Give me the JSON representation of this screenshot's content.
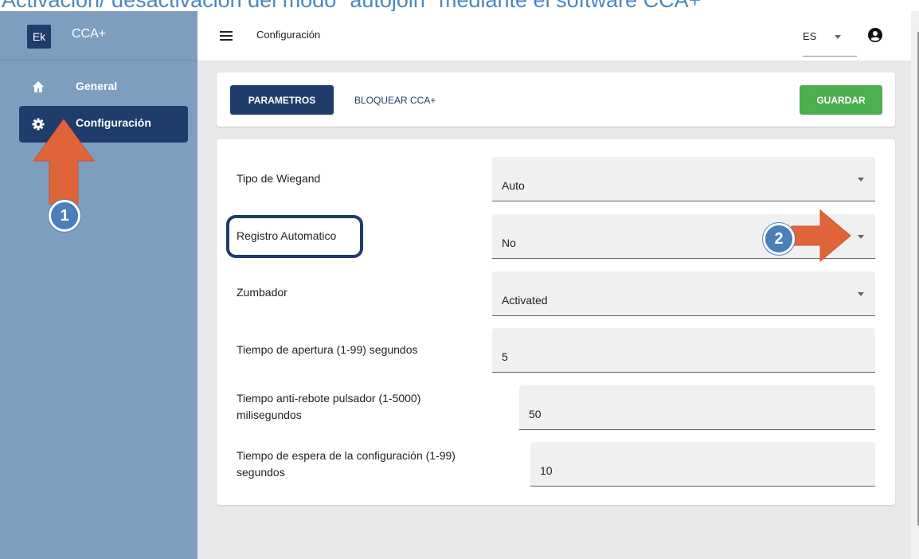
{
  "caption": "Activación/ desactivación del modo \"autojoin\" mediante el software CCA+",
  "app": {
    "logo": "Ek",
    "name": "CCA+"
  },
  "sidebar": {
    "items": [
      {
        "label": "General",
        "icon": "home-icon",
        "active": false
      },
      {
        "label": "Configuración",
        "icon": "gear-icon",
        "active": true
      }
    ]
  },
  "topbar": {
    "title": "Configuración",
    "language": "ES"
  },
  "toolbar": {
    "params_label": "PARAMETROS",
    "lock_label": "BLOQUEAR CCA+",
    "save_label": "GUARDAR"
  },
  "form": {
    "fields": [
      {
        "label": "Tipo de Wiegand",
        "value": "Auto",
        "type": "select"
      },
      {
        "label": "Registro Automatico",
        "value": "No",
        "type": "select"
      },
      {
        "label": "Zumbador",
        "value": "Activated",
        "type": "select"
      },
      {
        "label": "Tiempo de apertura (1-99) segundos",
        "value": "5",
        "type": "text"
      },
      {
        "label": "Tiempo anti-rebote pulsador (1-5000)",
        "label2": "milisegundos",
        "value": "50",
        "type": "text"
      },
      {
        "label": "Tiempo de espera de la configuración (1-99)",
        "label2": "segundos",
        "value": "10",
        "type": "text"
      }
    ]
  },
  "annotations": {
    "step1": "1",
    "step2": "2"
  },
  "colors": {
    "primary": "#1f3c6b",
    "sidebar": "#7e9ebf",
    "save": "#4caf50",
    "annotation_arrow": "#e0643a",
    "badge": "#4a7fba"
  }
}
